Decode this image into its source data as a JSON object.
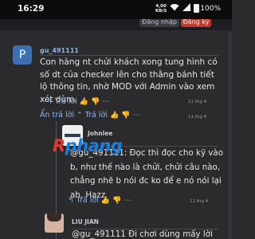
{
  "status_bar": {
    "time": "16:29",
    "network_speed_value": "4,00",
    "network_speed_unit": "KB/S",
    "battery": "100%",
    "icons": [
      "wifi-icon",
      "signal-icon",
      "battery-icon"
    ]
  },
  "header": {
    "login_label": "Đăng nhập",
    "register_label": "Đăng ký"
  },
  "post": {
    "avatar_letter": "P",
    "username": "gu_491111",
    "text": "Con hàng nt chửi khách xong tung hình có số dt của checker lên cho thằng bánh tiết lộ thông tin, nhờ MOD với Admin vào xem xét dùm.",
    "reply_label": "Trả lời",
    "timestamp": "11 thg 4",
    "hide_replies_label": "Ẩn trả lời",
    "hide_timestamp": "11 thg 4"
  },
  "watermark": "Rphang",
  "replies": [
    {
      "username": "Johnlee",
      "text": "@gu_491111: Đọc thì đọc cho kỹ vào b, như thế nào là chửi, chửi câu nào, chẳng nhẽ b nói đc ko để e nó nói lại ah. Hazz",
      "reply_label": "Trả lời",
      "timestamp": "11 thg 4"
    },
    {
      "username": "LIU JIAN",
      "text": "@gu_491111 Đi chơi dùng mấy lời"
    }
  ],
  "colors": {
    "background": "#2b2b2e",
    "link": "#8ab4f0",
    "avatar_blue": "#3d6fb5",
    "register": "#c0392b"
  }
}
